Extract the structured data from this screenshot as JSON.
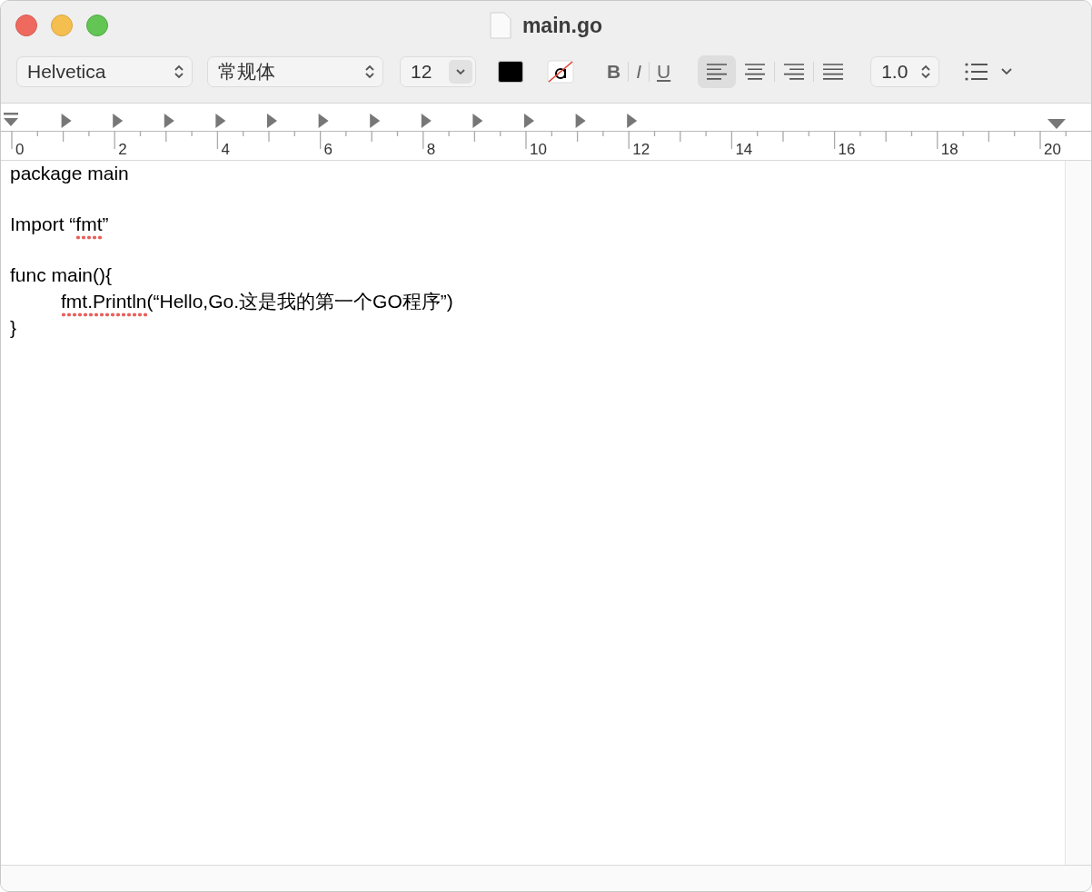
{
  "window": {
    "title": "main.go"
  },
  "toolbar": {
    "font_family": "Helvetica",
    "font_style": "常规体",
    "font_size": "12",
    "style_buttons": [
      {
        "label": "B",
        "kind": "bold"
      },
      {
        "label": "I",
        "kind": "italic"
      },
      {
        "label": "U",
        "kind": "underline"
      }
    ],
    "alignments": [
      {
        "kind": "left",
        "selected": true
      },
      {
        "kind": "center",
        "selected": false
      },
      {
        "kind": "right",
        "selected": false
      },
      {
        "kind": "justify",
        "selected": false
      }
    ],
    "line_spacing": "1.0"
  },
  "ruler": {
    "labels": [
      "0",
      "2",
      "4",
      "6",
      "8",
      "10",
      "12",
      "14",
      "16",
      "18",
      "20"
    ]
  },
  "document": {
    "lines": [
      {
        "gap_before": false,
        "indented": false,
        "segments": [
          {
            "text": "package main",
            "misspelled": false
          }
        ]
      },
      {
        "gap_before": true,
        "indented": false,
        "segments": [
          {
            "text": "Import “",
            "misspelled": false
          },
          {
            "text": "fmt",
            "misspelled": true
          },
          {
            "text": "”",
            "misspelled": false
          }
        ]
      },
      {
        "gap_before": true,
        "indented": false,
        "segments": [
          {
            "text": "func main(){",
            "misspelled": false
          }
        ]
      },
      {
        "gap_before": false,
        "indented": true,
        "segments": [
          {
            "text": "fmt.Println",
            "misspelled": true
          },
          {
            "text": "(“Hello,Go.这是我的第一个GO程序”)",
            "misspelled": false
          }
        ]
      },
      {
        "gap_before": false,
        "indented": false,
        "segments": [
          {
            "text": "}",
            "misspelled": false
          }
        ]
      }
    ]
  }
}
